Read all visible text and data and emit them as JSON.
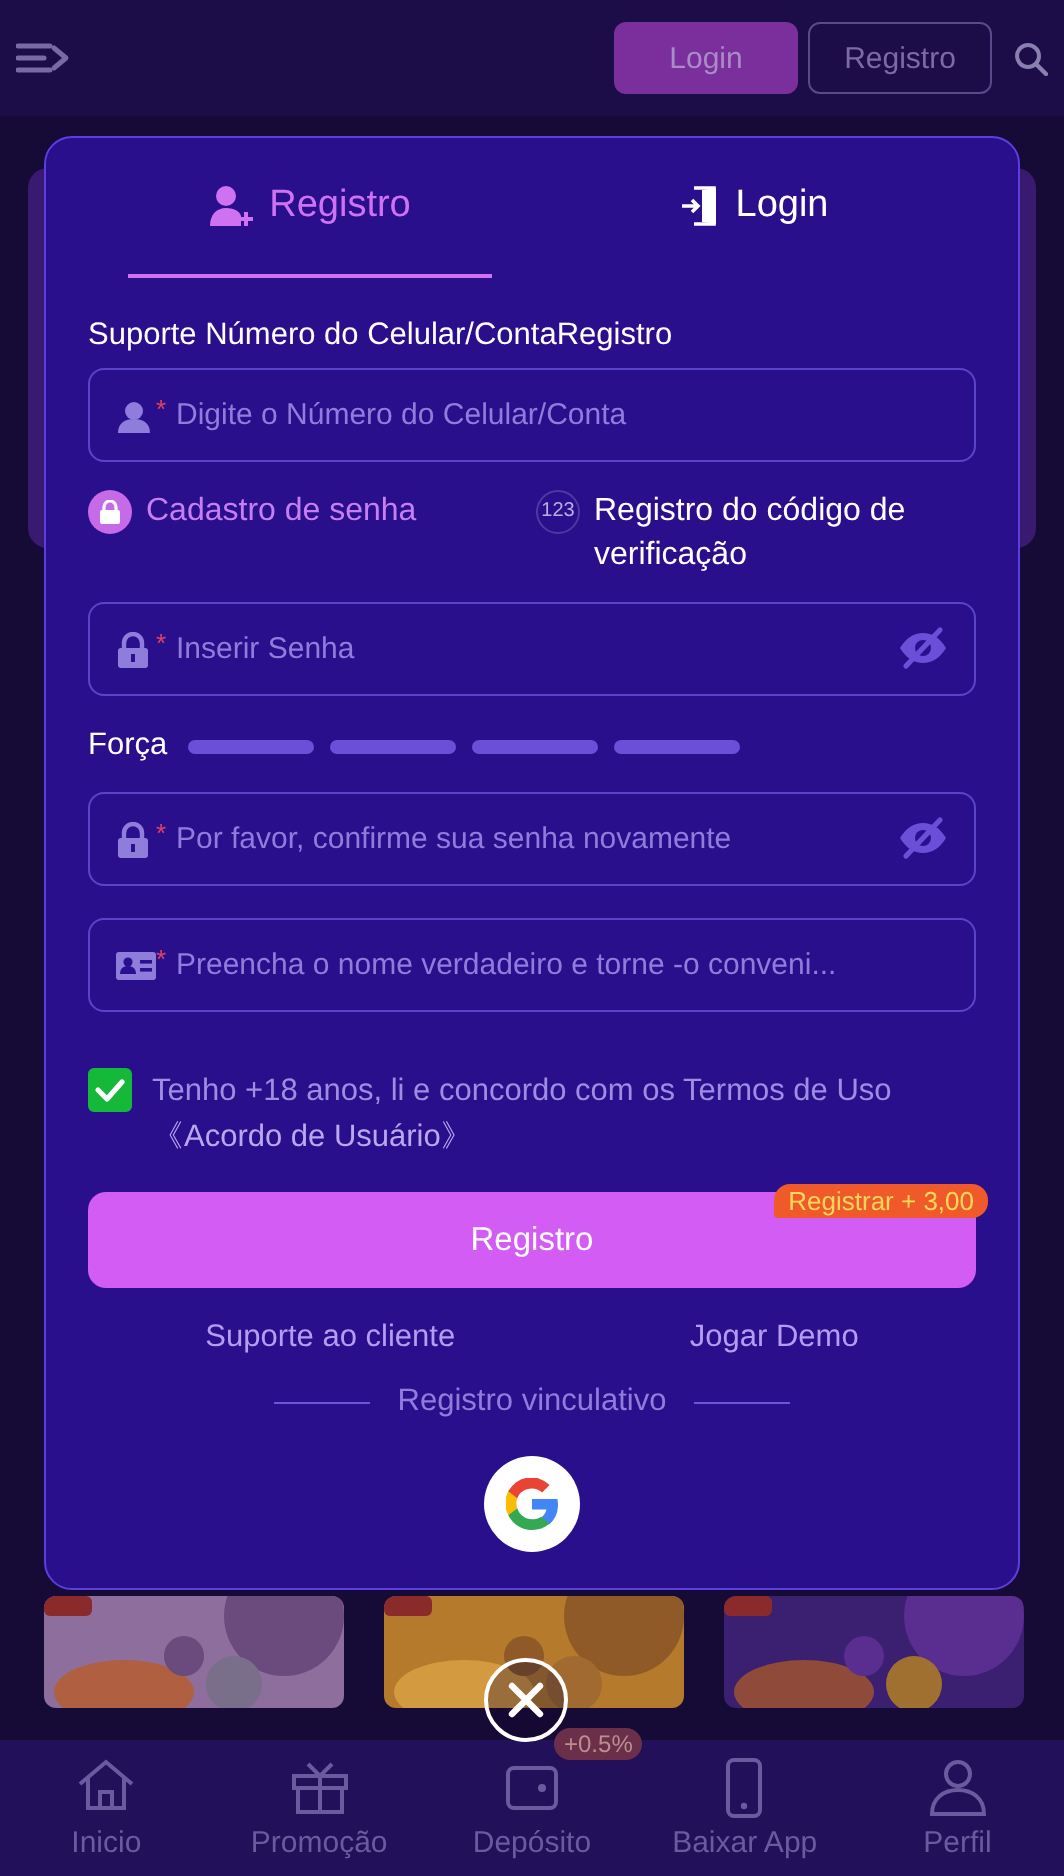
{
  "top_bar": {
    "buttons": [
      {
        "label": "Login",
        "kind": "filled"
      },
      {
        "label": "Registro",
        "kind": "outline"
      }
    ]
  },
  "modal": {
    "tabs": [
      {
        "label": "Registro",
        "kind": "register",
        "selected": true
      },
      {
        "label": "Login",
        "kind": "login",
        "selected": false
      }
    ],
    "account_label": "Suporte Número do Celular/ContaRegistro",
    "account_field": {
      "marker": "*",
      "placeholder": "Digite o Número do Celular/Conta"
    },
    "methods": [
      {
        "label": "Cadastro de senha",
        "kind": "lock",
        "selected": true
      },
      {
        "label": "Registro do código de verificação",
        "kind": "code",
        "icon_text": "123",
        "selected": false
      }
    ],
    "password_field": {
      "marker": "*",
      "placeholder": "Inserir Senha"
    },
    "strength": {
      "label": "Força"
    },
    "confirm_field": {
      "marker": "*",
      "placeholder": "Por favor, confirme sua senha novamente"
    },
    "name_field": {
      "marker": "*",
      "placeholder": "Preencha o nome verdadeiro e torne -o conveni..."
    },
    "agreement": {
      "checked": true,
      "text": "Tenho +18 anos, li e concordo com os Termos de Uso",
      "link": "《Acordo de Usuário》"
    },
    "submit": {
      "label": "Registro",
      "badge": "Registrar +  3,00"
    },
    "links": [
      "Suporte ao cliente",
      "Jogar Demo"
    ],
    "divider": "Registro vinculativo"
  },
  "bottom_nav": [
    {
      "label": "Inicio"
    },
    {
      "label": "Promoção"
    },
    {
      "label": "Depósito"
    },
    {
      "label": "Baixar App"
    },
    {
      "label": "Perfil"
    }
  ],
  "bottom_badge": "+0.5%"
}
